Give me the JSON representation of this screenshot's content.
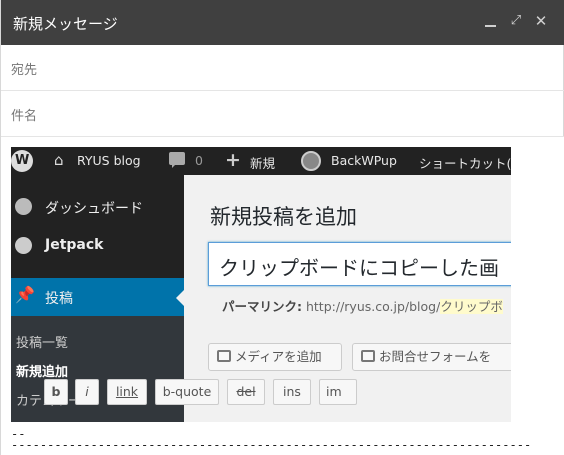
{
  "compose": {
    "title": "新規メッセージ",
    "to_label": "宛先",
    "subject_label": "件名"
  },
  "window_controls": [
    "minimize-icon",
    "popout-icon",
    "close-icon"
  ],
  "embedded_screenshot": {
    "adminbar": {
      "site": "RYUS blog",
      "comments_count": "0",
      "new_label": "新規",
      "backwpup_label": "BackWPup",
      "shortcut_label": "ショートカット(^"
    },
    "sidebar": {
      "dashboard": "ダッシュボード",
      "jetpack": "Jetpack",
      "posts": "投稿",
      "sub": [
        "投稿一覧",
        "新規追加",
        "カテゴリー"
      ]
    },
    "main": {
      "heading": "新規投稿を追加",
      "title_value": "クリップボードにコピーした画",
      "permalink_label": "パーマリンク:",
      "permalink_url": "http://ryus.co.jp/blog/",
      "permalink_slug": "クリップボ",
      "media_button": "メディアを追加",
      "form_button": "お問合せフォームを",
      "quicktags": [
        "b",
        "i",
        "link",
        "b-quote",
        "del",
        "ins",
        "im"
      ]
    }
  },
  "signature": {
    "line1": "--",
    "line2": "---------------------------------------------------------------------------"
  }
}
